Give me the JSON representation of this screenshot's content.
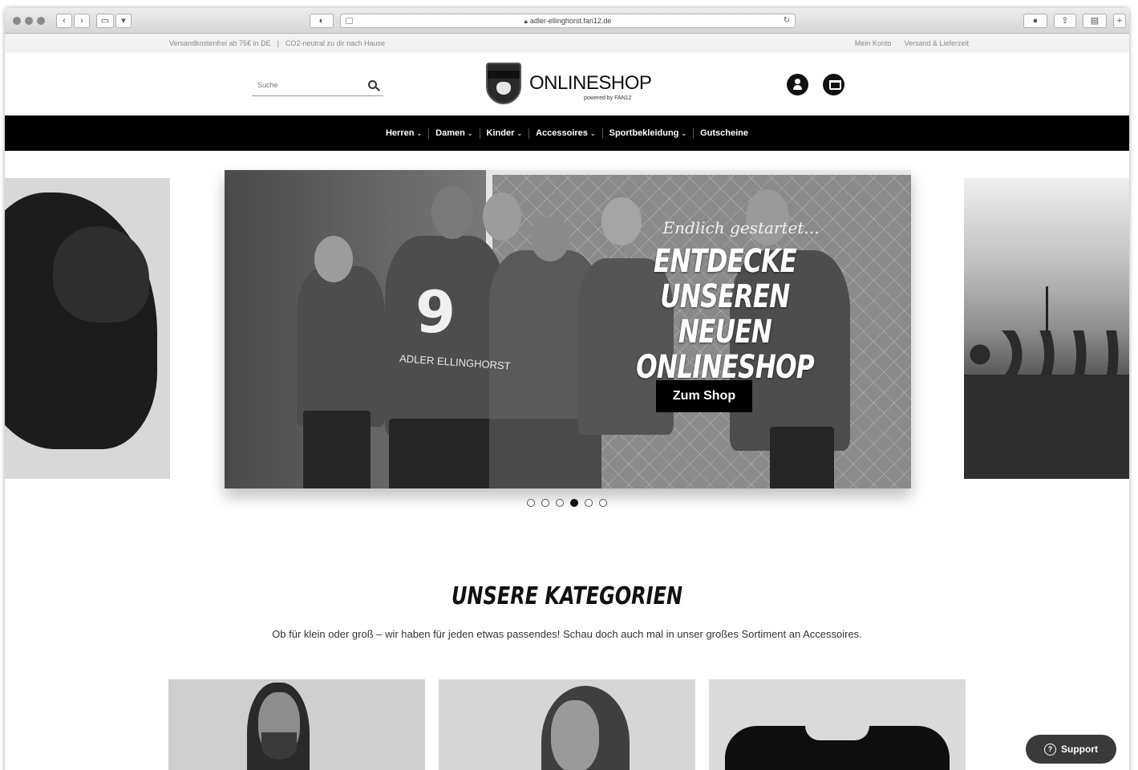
{
  "browser": {
    "url": "adler-ellinghorst.fan12.de",
    "reader_icon": "reader-icon",
    "reload_icon": "↻"
  },
  "topstrip": {
    "left_1": "Versandkostenfrei ab 75€ in DE",
    "separator": "|",
    "left_2": "CO2-neutral zu dir nach Hause",
    "right_1": "Mein Konto",
    "right_2": "Versand & Lieferzeit"
  },
  "header": {
    "search_placeholder": "Suche",
    "brand": "ONLINESHOP",
    "crest_text": "ADLER",
    "powered": "powered by FAN12"
  },
  "nav": {
    "items": [
      "Herren",
      "Damen",
      "Kinder",
      "Accessoires",
      "Sportbekleidung",
      "Gutscheine"
    ]
  },
  "hero": {
    "script": "Endlich gestartet...",
    "line1": "ENTDECKE",
    "line2": "UNSEREN NEUEN",
    "line3": "ONLINESHOP",
    "jersey_number": "9",
    "jersey_name": "ADLER ELLINGHORST",
    "button": "Zum Shop",
    "slides_total": 6,
    "active_slide": 4
  },
  "categories": {
    "title": "UNSERE KATEGORIEN",
    "subtitle": "Ob für klein oder groß – wir haben für jeden etwas passendes! Schau doch auch mal in unser großes Sortiment an Accessoires."
  },
  "support": {
    "label": "Support"
  },
  "colors": {
    "nav_bg": "#000000",
    "accent": "#111111"
  }
}
